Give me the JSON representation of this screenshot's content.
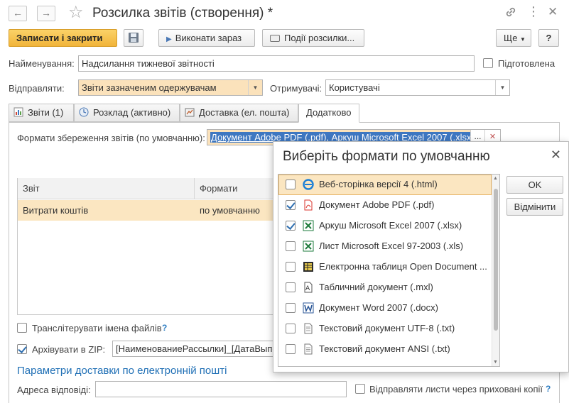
{
  "window": {
    "title": "Розсилка звітів (створення) *",
    "nav_back": "←",
    "nav_forward": "→"
  },
  "toolbar": {
    "save_close": "Записати і закрити",
    "run_now": "Виконати зараз",
    "events": "Події розсилки...",
    "more": "Ще",
    "help": "?"
  },
  "form": {
    "name_label": "Найменування:",
    "name_value": "Надсилання тижневої звітності",
    "prepared_label": "Підготовлена",
    "prepared_checked": false,
    "send_label": "Відправляти:",
    "send_value": "Звіти зазначеним одержувачам",
    "recipients_label": "Отримувачі:",
    "recipients_value": "Користувачі"
  },
  "tabs": [
    {
      "label": "Звіти (1)",
      "icon": "report-icon",
      "active": false
    },
    {
      "label": "Розклад (активно)",
      "icon": "clock-icon",
      "active": false
    },
    {
      "label": "Доставка (ел. пошта)",
      "icon": "delivery-icon",
      "active": false
    },
    {
      "label": "Додатково",
      "icon": "",
      "active": true
    }
  ],
  "additional": {
    "formats_label": "Формати збереження звітів (по умовчанню):",
    "formats_value": "Документ Adobe PDF (.pdf), Аркуш Microsoft Excel 2007 (.xlsx)",
    "table_headers": [
      "Звіт",
      "Формати"
    ],
    "table_rows": [
      {
        "report": "Витрати коштів",
        "formats": "по умовчанню"
      }
    ],
    "transliterate_label": "Транслітерувати імена файлів",
    "transliterate_checked": false,
    "archive_label": "Архівувати в ZIP:",
    "archive_checked": true,
    "archive_value": "[НаименованиеРассылки]_[ДатаВыполнения]",
    "email_params_title": "Параметри доставки по електронній пошті",
    "reply_label": "Адреса відповіді:",
    "reply_value": "",
    "hidden_copies_label": "Відправляти листи через приховані копії",
    "help_mark": "?"
  },
  "popup": {
    "title": "Виберіть формати по умовчанню",
    "ok": "OK",
    "cancel": "Відмінити",
    "items": [
      {
        "label": "Веб-сторінка версії 4 (.html)",
        "checked": false,
        "icon": "web-page-icon",
        "selected": true
      },
      {
        "label": "Документ Adobe PDF (.pdf)",
        "checked": true,
        "icon": "pdf-icon",
        "selected": false
      },
      {
        "label": "Аркуш Microsoft Excel 2007 (.xlsx)",
        "checked": true,
        "icon": "excel-icon",
        "selected": false
      },
      {
        "label": "Лист Microsoft Excel 97-2003 (.xls)",
        "checked": false,
        "icon": "excel-icon",
        "selected": false
      },
      {
        "label": "Електронна таблиця Open Document ...",
        "checked": false,
        "icon": "ods-icon",
        "selected": false
      },
      {
        "label": "Табличний документ (.mxl)",
        "checked": false,
        "icon": "mxl-icon",
        "selected": false
      },
      {
        "label": "Документ Word 2007 (.docx)",
        "checked": false,
        "icon": "word-icon",
        "selected": false
      },
      {
        "label": "Текстовий документ UTF-8 (.txt)",
        "checked": false,
        "icon": "text-file-icon",
        "selected": false
      },
      {
        "label": "Текстовий документ ANSI (.txt)",
        "checked": false,
        "icon": "text-file-icon",
        "selected": false
      }
    ]
  },
  "colors": {
    "primary_button": "#f1b43a",
    "link": "#1f6fb5",
    "selection": "#fbe6c1",
    "field_highlight": "#fbe2bb"
  }
}
